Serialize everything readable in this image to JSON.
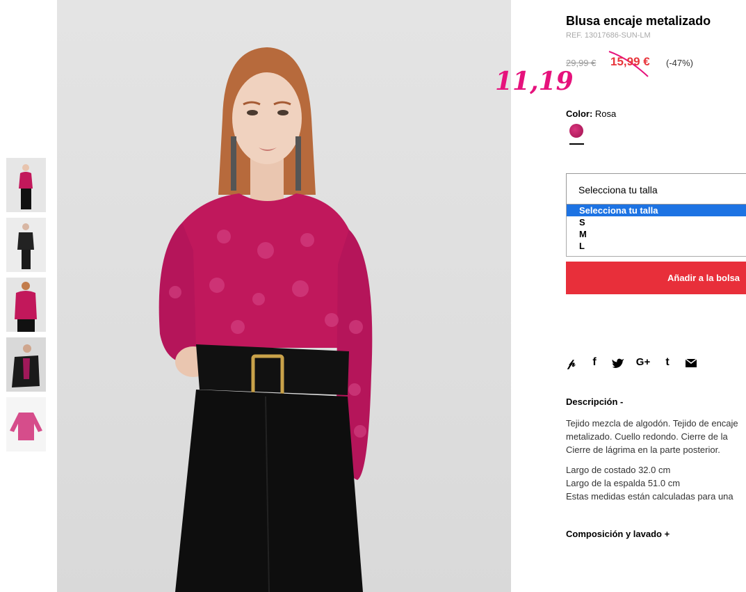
{
  "product": {
    "title": "Blusa encaje metalizado",
    "ref": "REF. 13017686-SUN-LM",
    "old_price": "29,99 €",
    "new_price": "15,99 €",
    "discount": "(-47%)",
    "handwritten_price": "11,19"
  },
  "color": {
    "label": "Color:",
    "value": "Rosa",
    "swatch_color": "#b8195f"
  },
  "size": {
    "placeholder": "Selecciona tu talla",
    "options": [
      "Selecciona tu talla",
      "S",
      "M",
      "L"
    ]
  },
  "add_button": "Añadir a la bolsa",
  "share_icons": [
    "pinterest-icon",
    "facebook-icon",
    "twitter-icon",
    "google-plus-icon",
    "tumblr-icon",
    "email-icon"
  ],
  "description": {
    "heading": "Descripción -",
    "para1": [
      "Tejido mezcla de algodón. Tejido de encaje",
      "metalizado. Cuello redondo. Cierre de la",
      "Cierre de lágrima en la parte posterior."
    ],
    "para2": [
      "Largo de costado 32.0 cm",
      "Largo de la espalda 51.0 cm",
      "Estas medidas están calculadas para una"
    ]
  },
  "composition_heading": "Composición y lavado +",
  "colors": {
    "sale_red": "#e8353b",
    "button_red": "#e82f3a",
    "select_blue": "#1d73e3",
    "annotation_pink": "#e6127c"
  }
}
